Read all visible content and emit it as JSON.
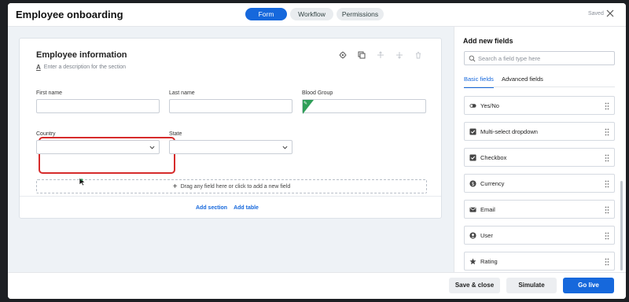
{
  "header": {
    "title": "Employee onboarding",
    "tabs": [
      "Form",
      "Workflow",
      "Permissions"
    ],
    "saved_label": "Saved"
  },
  "section": {
    "title": "Employee information",
    "description_placeholder": "Enter a description for the section"
  },
  "fields": {
    "first_name": {
      "label": "First name",
      "value": ""
    },
    "last_name": {
      "label": "Last name",
      "value": ""
    },
    "blood_group": {
      "label": "Blood Group",
      "value": ""
    },
    "country": {
      "label": "Country",
      "value": ""
    },
    "state": {
      "label": "State",
      "value": ""
    }
  },
  "dropzone": {
    "text": "Drag any field here or click to add a new field"
  },
  "section_links": {
    "add_section": "Add section",
    "add_table": "Add table"
  },
  "panel": {
    "title": "Add new fields",
    "search_placeholder": "Search a field type here",
    "tabs": [
      "Basic fields",
      "Advanced fields"
    ],
    "items": [
      {
        "label": "Yes/No",
        "icon": "toggle-icon"
      },
      {
        "label": "Multi-select dropdown",
        "icon": "checkbox-icon"
      },
      {
        "label": "Checkbox",
        "icon": "checkbox-icon"
      },
      {
        "label": "Currency",
        "icon": "currency-icon"
      },
      {
        "label": "Email",
        "icon": "email-icon"
      },
      {
        "label": "User",
        "icon": "user-icon"
      },
      {
        "label": "Rating",
        "icon": "star-icon"
      }
    ]
  },
  "footer": {
    "save_close": "Save & close",
    "simulate": "Simulate",
    "go_live": "Go live"
  },
  "colors": {
    "accent": "#1668dc",
    "highlight": "#d62b2b",
    "tag": "#2f9e58"
  }
}
